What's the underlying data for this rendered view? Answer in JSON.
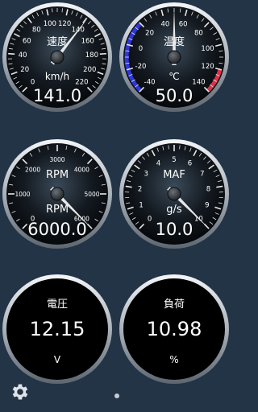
{
  "gauges": {
    "speed": {
      "title": "速度",
      "unit": "km/h",
      "value_text": "141.0",
      "ticks": [
        "0",
        "20",
        "40",
        "60",
        "80",
        "100",
        "120",
        "140",
        "160",
        "180",
        "200",
        "220"
      ],
      "min": 0,
      "max": 220,
      "value": 141
    },
    "temp": {
      "title": "温度",
      "unit": "℃",
      "value_text": "50.0",
      "ticks": [
        "-40",
        "-20",
        "0",
        "20",
        "40",
        "60",
        "80",
        "100",
        "120",
        "140"
      ],
      "min": -40,
      "max": 140,
      "value": 50,
      "colors": {
        "cold_arc": "#2f37d8",
        "hot_arc": "#e0304a"
      }
    },
    "rpm": {
      "title": "RPM",
      "unit": "RPM",
      "value_text": "6000.0",
      "ticks": [
        "0",
        "1000",
        "2000",
        "3000",
        "4000",
        "5000",
        "6000"
      ],
      "min": 0,
      "max": 6000,
      "value": 6000
    },
    "maf": {
      "title": "MAF",
      "unit": "g/s",
      "value_text": "10.0",
      "ticks": [
        "0",
        "1",
        "2",
        "3",
        "4",
        "5",
        "6",
        "7",
        "8",
        "9",
        "10"
      ],
      "min": 0,
      "max": 10,
      "value": 10
    },
    "voltage": {
      "title": "電圧",
      "value_text": "12.15",
      "unit": "V"
    },
    "load": {
      "title": "負荷",
      "value_text": "10.98",
      "unit": "%"
    }
  },
  "icons": {
    "settings": "gear-icon",
    "pager": "page-indicator-dot"
  },
  "colors": {
    "background": "#233447",
    "needle": "#e8e8e8",
    "text": "#ffffff"
  }
}
